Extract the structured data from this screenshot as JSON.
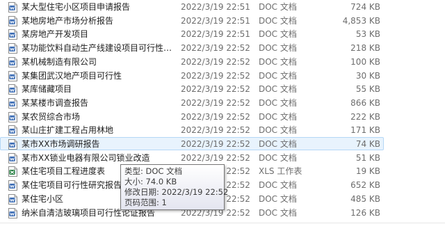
{
  "files": [
    {
      "name": "某大型住宅小区项目申请报告",
      "date": "2022/3/19 22:51",
      "type": "DOC 文档",
      "size": "724 KB",
      "icon": "word-doc-icon"
    },
    {
      "name": "某地房地产市场分析报告",
      "date": "2022/3/19 22:51",
      "type": "DOC 文档",
      "size": "4,853 KB",
      "icon": "word-doc-icon"
    },
    {
      "name": "某房地产开发项目",
      "date": "2022/3/19 22:51",
      "type": "DOC 文档",
      "size": "53 KB",
      "icon": "word-doc-icon"
    },
    {
      "name": "某功能饮料自动生产线建设项目可行性报...",
      "date": "2022/3/19 22:52",
      "type": "DOC 文档",
      "size": "218 KB",
      "icon": "word-doc-icon"
    },
    {
      "name": "某机械制造有限公司",
      "date": "2022/3/19 22:52",
      "type": "DOC 文档",
      "size": "100 KB",
      "icon": "word-doc-icon"
    },
    {
      "name": "某集团武汉地产项目可行性",
      "date": "2022/3/19 22:52",
      "type": "DOC 文档",
      "size": "30 KB",
      "icon": "word-doc-icon"
    },
    {
      "name": "某库储藏项目",
      "date": "2022/3/19 22:52",
      "type": "DOC 文档",
      "size": "55 KB",
      "icon": "word-doc-icon"
    },
    {
      "name": "某某楼市调查报告",
      "date": "2022/3/19 22:52",
      "type": "DOC 文档",
      "size": "866 KB",
      "icon": "word-doc-icon"
    },
    {
      "name": "某农贸综合市场",
      "date": "2022/3/19 22:52",
      "type": "DOC 文档",
      "size": "222 KB",
      "icon": "word-doc-icon"
    },
    {
      "name": "某山庄扩建工程占用林地",
      "date": "2022/3/19 22:52",
      "type": "DOC 文档",
      "size": "171 KB",
      "icon": "word-doc-icon"
    },
    {
      "name": "某市XX市场调研报告",
      "date": "2022/3/19 22:52",
      "type": "DOC 文档",
      "size": "74 KB",
      "icon": "word-doc-icon",
      "hover": true
    },
    {
      "name": "某市XX锁业电器有限公司锁业改造",
      "date": "2022/3/19 22:52",
      "type": "DOC 文档",
      "size": "51 KB",
      "icon": "word-doc-icon"
    },
    {
      "name": "某住宅项目工程进度表",
      "date": "2022/3/19 22:52",
      "type": "XLS 工作表",
      "size": "19 KB",
      "icon": "excel-xls-icon"
    },
    {
      "name": "某住宅项目可行性研究报告",
      "date": "2022/3/19 22:52",
      "type": "DOC 文档",
      "size": "652 KB",
      "icon": "word-doc-icon"
    },
    {
      "name": "某住宅小区",
      "date": "2022/3/19 22:52",
      "type": "DOC 文档",
      "size": "485 KB",
      "icon": "word-doc-icon"
    },
    {
      "name": "纳米自清洁玻璃项目可行性论证报告",
      "date": "2022/3/19 22:52",
      "type": "DOC 文档",
      "size": "126 KB",
      "icon": "word-doc-icon"
    }
  ],
  "tooltip": {
    "type_line": "类型: DOC 文档",
    "size_line": "大小: 74.0 KB",
    "modified_line": "修改日期: 2022/3/19 22:52",
    "pages_line": "页码范围: 1"
  },
  "colors": {
    "hover_bg": "#e8f3fd",
    "hover_border": "#b4d7f6",
    "word_icon": "#2a5fad",
    "excel_icon": "#1f7a3c",
    "secondary_text": "#6d6d6d"
  }
}
